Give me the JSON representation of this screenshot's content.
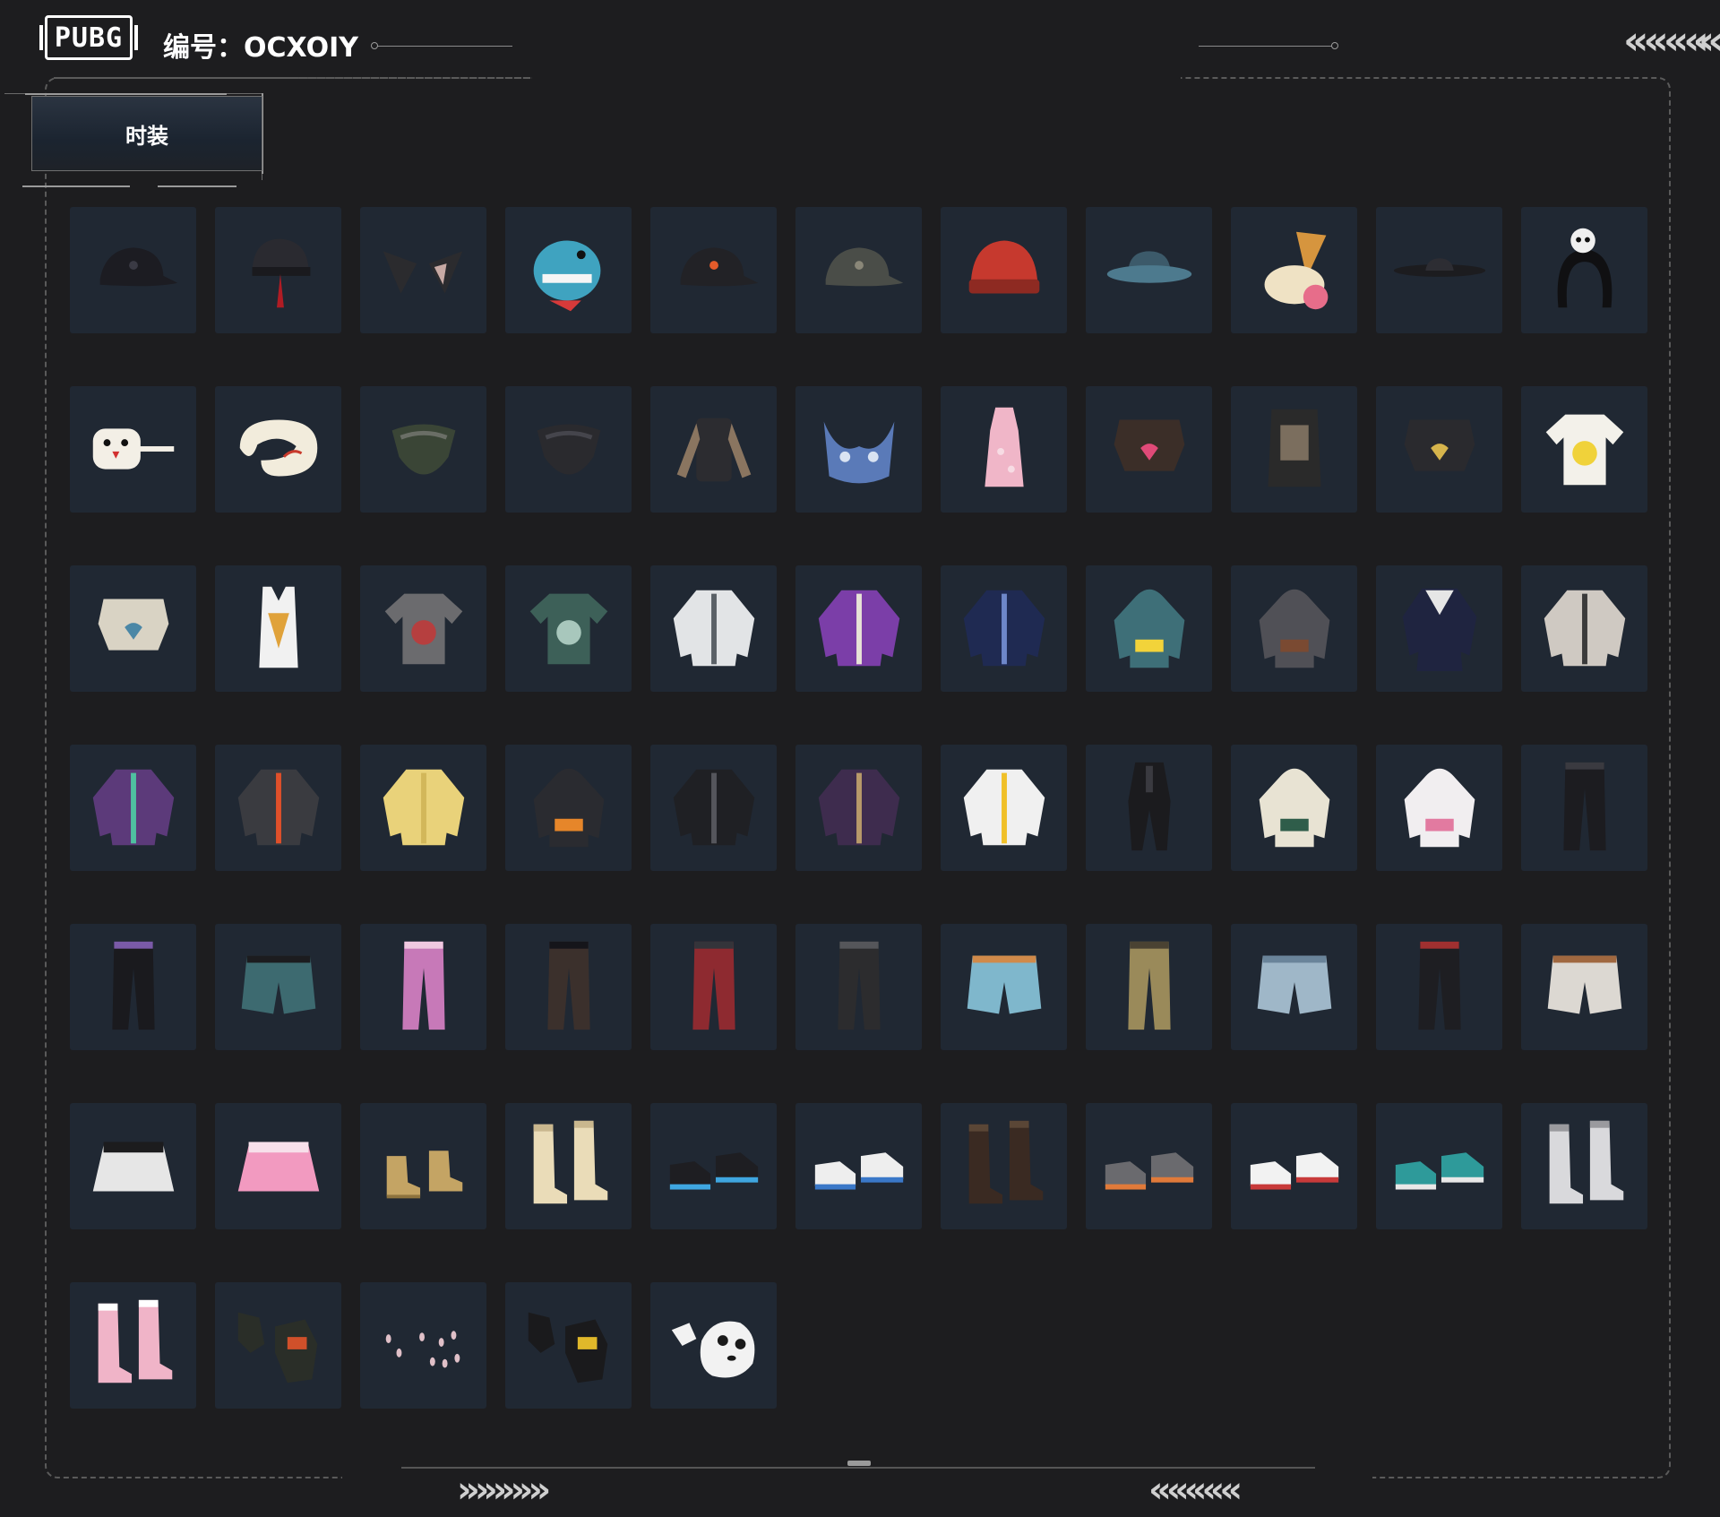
{
  "header": {
    "logo_text": "PUBG",
    "id_label": "编号：OCXOIY"
  },
  "category_tab": {
    "label": "时装"
  },
  "decor": {
    "top_right_chevrons": "««««",
    "top_right_chevron_partial": "«",
    "footer_left_chevrons": "»»»»»",
    "footer_right_chevrons": "«««««"
  },
  "colors": {
    "background": "#1d1d1f",
    "tile": "#202833",
    "frame_dash": "#5a5a5a"
  },
  "items": [
    {
      "icon": "black-cap-icon",
      "kind": "cap",
      "c1": "#1c1c22",
      "c2": "#3a3a44"
    },
    {
      "icon": "red-trim-helmet-icon",
      "kind": "helmet",
      "c1": "#2a2a30",
      "c2": "#b01c24"
    },
    {
      "icon": "cat-ears-icon",
      "kind": "ears",
      "c1": "#2b2b2e",
      "c2": "#c7a9a4"
    },
    {
      "icon": "dinosaur-mask-icon",
      "kind": "mask",
      "c1": "#3fa3c0",
      "c2": "#d73a3a"
    },
    {
      "icon": "black-cap-orange-logo-icon",
      "kind": "cap",
      "c1": "#222226",
      "c2": "#e55b2a"
    },
    {
      "icon": "grey-camo-cap-icon",
      "kind": "cap",
      "c1": "#4a4d48",
      "c2": "#8a8778"
    },
    {
      "icon": "red-beanie-icon",
      "kind": "beanie",
      "c1": "#c6392e",
      "c2": "#8e2a22"
    },
    {
      "icon": "bucket-hat-icon",
      "kind": "bucket",
      "c1": "#3c5a6a",
      "c2": "#4d7a8e"
    },
    {
      "icon": "ice-cream-hat-icon",
      "kind": "icecream",
      "c1": "#d6953e",
      "c2": "#e76d8a"
    },
    {
      "icon": "wide-brim-hat-icon",
      "kind": "brim",
      "c1": "#1c1c1f",
      "c2": "#2d2d33"
    },
    {
      "icon": "panda-headband-icon",
      "kind": "headband",
      "c1": "#101012",
      "c2": "#f0f0f0"
    },
    {
      "icon": "chicken-mask-icon",
      "kind": "chicken",
      "c1": "#f3efe6",
      "c2": "#d23030"
    },
    {
      "icon": "neck-pillow-icon",
      "kind": "pillow",
      "c1": "#f2ecdc",
      "c2": "#c83a2c"
    },
    {
      "icon": "camo-bandana-icon",
      "kind": "bandana",
      "c1": "#3a4536",
      "c2": "#6a6e66"
    },
    {
      "icon": "black-bandana-icon",
      "kind": "bandana",
      "c1": "#2a2a2e",
      "c2": "#45454c"
    },
    {
      "icon": "tattoo-shirt-icon",
      "kind": "longshirt",
      "c1": "#2c2c30",
      "c2": "#8a7560"
    },
    {
      "icon": "floral-bikini-icon",
      "kind": "bikini",
      "c1": "#5a7ab8",
      "c2": "#d9e3f2"
    },
    {
      "icon": "pink-qipao-icon",
      "kind": "dress",
      "c1": "#f0b6c8",
      "c2": "#f7dce4"
    },
    {
      "icon": "crop-jacket-heart-icon",
      "kind": "crop",
      "c1": "#3b2e28",
      "c2": "#e04a78"
    },
    {
      "icon": "printed-vest-icon",
      "kind": "vest",
      "c1": "#2a2a2a",
      "c2": "#7b6e5e"
    },
    {
      "icon": "chain-crop-top-icon",
      "kind": "crop",
      "c1": "#2a2a2e",
      "c2": "#d6b44c"
    },
    {
      "icon": "yellow-tshirt-icon",
      "kind": "tshirt",
      "c1": "#f3f1ea",
      "c2": "#f0d23a"
    },
    {
      "icon": "knit-crop-top-icon",
      "kind": "crop",
      "c1": "#d9d3c4",
      "c2": "#4b87a6"
    },
    {
      "icon": "white-tank-top-icon",
      "kind": "tank",
      "c1": "#f1f1f1",
      "c2": "#e0a23a"
    },
    {
      "icon": "grey-rose-tee-icon",
      "kind": "tshirt",
      "c1": "#6b6b6e",
      "c2": "#b63f3f"
    },
    {
      "icon": "floral-shirt-icon",
      "kind": "tshirt",
      "c1": "#3d6058",
      "c2": "#a8c7bc"
    },
    {
      "icon": "white-crop-jacket-icon",
      "kind": "jacket",
      "c1": "#e2e4e6",
      "c2": "#5a6066"
    },
    {
      "icon": "purple-track-jacket-icon",
      "kind": "jacket",
      "c1": "#7b3ea8",
      "c2": "#e7e3d6"
    },
    {
      "icon": "navy-sweatshirt-icon",
      "kind": "jacket",
      "c1": "#1f2a52",
      "c2": "#6e87c9"
    },
    {
      "icon": "duck-hoodie-icon",
      "kind": "hoodie",
      "c1": "#3e6f78",
      "c2": "#f2d33a"
    },
    {
      "icon": "grey-hood-vest-icon",
      "kind": "hoodie",
      "c1": "#505056",
      "c2": "#7a4a32"
    },
    {
      "icon": "navy-sailor-coat-icon",
      "kind": "coat",
      "c1": "#1f2440",
      "c2": "#e6e6e6"
    },
    {
      "icon": "silver-bomber-icon",
      "kind": "jacket",
      "c1": "#cfc9c2",
      "c2": "#3a3a3a"
    },
    {
      "icon": "purple-mint-jacket-icon",
      "kind": "jacket",
      "c1": "#5c3a7a",
      "c2": "#4fc0a0"
    },
    {
      "icon": "orange-moto-jacket-icon",
      "kind": "jacket",
      "c1": "#3a3b40",
      "c2": "#e0502a"
    },
    {
      "icon": "yellow-fur-jacket-icon",
      "kind": "jacket",
      "c1": "#e9d27a",
      "c2": "#d2b75a"
    },
    {
      "icon": "orange-hood-jacket-icon",
      "kind": "hoodie",
      "c1": "#2a2b30",
      "c2": "#e6862a"
    },
    {
      "icon": "black-leather-jacket-icon",
      "kind": "jacket",
      "c1": "#1f2024",
      "c2": "#55565c"
    },
    {
      "icon": "purple-gold-bomber-icon",
      "kind": "jacket",
      "c1": "#3e2c4e",
      "c2": "#b89a6a"
    },
    {
      "icon": "yellow-white-jacket-icon",
      "kind": "jacket",
      "c1": "#f0f0f0",
      "c2": "#f0c028"
    },
    {
      "icon": "black-jumpsuit-icon",
      "kind": "suit",
      "c1": "#1b1b1e",
      "c2": "#3a3a40"
    },
    {
      "icon": "cream-hoodie-icon",
      "kind": "hoodie",
      "c1": "#e8e3d3",
      "c2": "#2f5d4a"
    },
    {
      "icon": "pink-white-hoodie-icon",
      "kind": "hoodie",
      "c1": "#f1eef0",
      "c2": "#e27aa0"
    },
    {
      "icon": "black-pants-icon",
      "kind": "pants",
      "c1": "#1c1c20",
      "c2": "#3a3a40"
    },
    {
      "icon": "black-track-pants-icon",
      "kind": "pants",
      "c1": "#1a1a1e",
      "c2": "#7a5aa8"
    },
    {
      "icon": "teal-shorts-leggings-icon",
      "kind": "shorts",
      "c1": "#3d6a70",
      "c2": "#1c1c1f"
    },
    {
      "icon": "pink-cargo-pants-icon",
      "kind": "pants",
      "c1": "#c779b8",
      "c2": "#f0c8e0"
    },
    {
      "icon": "brown-kneepad-pants-icon",
      "kind": "pants",
      "c1": "#3b302c",
      "c2": "#15151a"
    },
    {
      "icon": "red-striped-leggings-icon",
      "kind": "pants",
      "c1": "#8e2a30",
      "c2": "#34343a"
    },
    {
      "icon": "tactical-pants-icon",
      "kind": "pants",
      "c1": "#2c2c2e",
      "c2": "#55565a"
    },
    {
      "icon": "blue-shorts-icon",
      "kind": "shorts",
      "c1": "#7fb7cc",
      "c2": "#d08a4a"
    },
    {
      "icon": "gold-camo-pants-icon",
      "kind": "pants",
      "c1": "#9a8a5a",
      "c2": "#4a4232"
    },
    {
      "icon": "denim-shorts-icon",
      "kind": "shorts",
      "c1": "#9fb7c8",
      "c2": "#6a849a"
    },
    {
      "icon": "black-jeans-icon",
      "kind": "pants",
      "c1": "#1e1e22",
      "c2": "#a03030"
    },
    {
      "icon": "white-shorts-icon",
      "kind": "shorts",
      "c1": "#dcd8d2",
      "c2": "#a06840"
    },
    {
      "icon": "black-white-skirt-icon",
      "kind": "skirt",
      "c1": "#e6e6e6",
      "c2": "#1c1c1e"
    },
    {
      "icon": "pink-pleated-skirt-icon",
      "kind": "skirt",
      "c1": "#f29ac0",
      "c2": "#f7e0ea"
    },
    {
      "icon": "tan-boots-icon",
      "kind": "boots",
      "c1": "#c4a464",
      "c2": "#8e733e"
    },
    {
      "icon": "cream-heel-boots-icon",
      "kind": "tallboots",
      "c1": "#eadcb8",
      "c2": "#c9b78e"
    },
    {
      "icon": "black-blue-boots-icon",
      "kind": "sneakers",
      "c1": "#1e1e22",
      "c2": "#3fa6e0"
    },
    {
      "icon": "white-blue-sneakers-icon",
      "kind": "sneakers",
      "c1": "#eeeeee",
      "c2": "#3a78c8"
    },
    {
      "icon": "brown-lace-boots-icon",
      "kind": "tallboots",
      "c1": "#3a2a22",
      "c2": "#5a4636"
    },
    {
      "icon": "grey-orange-sneakers-icon",
      "kind": "sneakers",
      "c1": "#6a6a6e",
      "c2": "#e07a3a"
    },
    {
      "icon": "white-red-sneakers-icon",
      "kind": "sneakers",
      "c1": "#f2f2f2",
      "c2": "#c83a3a"
    },
    {
      "icon": "teal-clogs-icon",
      "kind": "sneakers",
      "c1": "#2e9a9a",
      "c2": "#e8e8e8"
    },
    {
      "icon": "white-tall-boots-icon",
      "kind": "tallboots",
      "c1": "#d9d9dc",
      "c2": "#9a9a9e"
    },
    {
      "icon": "pink-fishnet-boots-icon",
      "kind": "tallboots",
      "c1": "#f0b4c8",
      "c2": "#ffffff"
    },
    {
      "icon": "black-red-gloves-icon",
      "kind": "gloves",
      "c1": "#2a2e28",
      "c2": "#d0502a"
    },
    {
      "icon": "nail-set-icon",
      "kind": "nails",
      "c1": "#e0c0c8",
      "c2": "#ffffff"
    },
    {
      "icon": "yellow-black-gloves-icon",
      "kind": "gloves",
      "c1": "#1a1a1c",
      "c2": "#e0b82a"
    },
    {
      "icon": "panda-gloves-icon",
      "kind": "panda",
      "c1": "#f2f2f2",
      "c2": "#1a1a1a"
    }
  ]
}
